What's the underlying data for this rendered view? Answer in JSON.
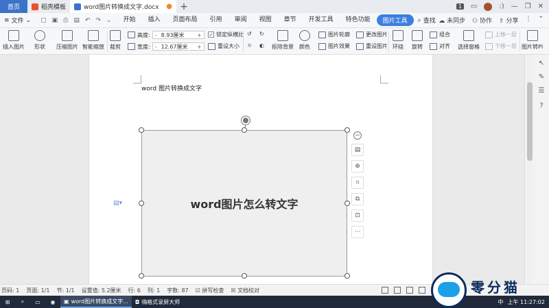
{
  "titlebar": {
    "home_tab": "首页",
    "template_tab": "稻壳模板",
    "doc_tab": "word图片转换成文字.docx",
    "new_tab": "+",
    "badge": "1",
    "user": ":)"
  },
  "menubar": {
    "file": "文件",
    "menus": [
      "开始",
      "插入",
      "页面布局",
      "引用",
      "审阅",
      "视图",
      "章节",
      "开发工具",
      "特色功能",
      "图片工具"
    ],
    "active_menu": "图片工具",
    "search": "查找",
    "sync": "未同步",
    "collab": "协作",
    "share": "分享"
  },
  "ribbon": {
    "insert_image": "插入图片",
    "shape": "形状",
    "compress": "压缩图片",
    "smart_scale": "智能缩放",
    "crop": "裁剪",
    "height_label": "高度:",
    "height_value": "8.93厘米",
    "width_label": "宽度:",
    "width_value": "12.67厘米",
    "lock_ratio": "锁定纵横比",
    "reset_size": "重设大小",
    "remove_bg": "抠除背景",
    "color": "颜色",
    "outline": "图片轮廓",
    "effect": "图片效果",
    "change_image": "更改图片",
    "reset_image": "重设图片",
    "wrap": "环绕",
    "rotate": "旋转",
    "group": "组合",
    "align": "对齐",
    "selection_pane": "选择窗格",
    "bring_forward": "上移一层",
    "send_backward": "下移一层",
    "image_convert": "图片转PI"
  },
  "document": {
    "body_text": "word 图片转换成文字",
    "image_text": "word图片怎么转文字"
  },
  "statusbar": {
    "page_no": "页码: 1",
    "page": "页面: 1/1",
    "section": "节: 1/1",
    "setting": "设置值: 5.2厘米",
    "row": "行: 6",
    "col": "列: 1",
    "words": "字数: 87",
    "spell": "拼写检查",
    "proof": "文档校对"
  },
  "taskbar": {
    "app1": "word图片转换成文字...",
    "app2": "嗨格式录屏大师",
    "ime": "中",
    "time": "上午 11:27:02"
  },
  "logo": {
    "text": "零分猫"
  }
}
